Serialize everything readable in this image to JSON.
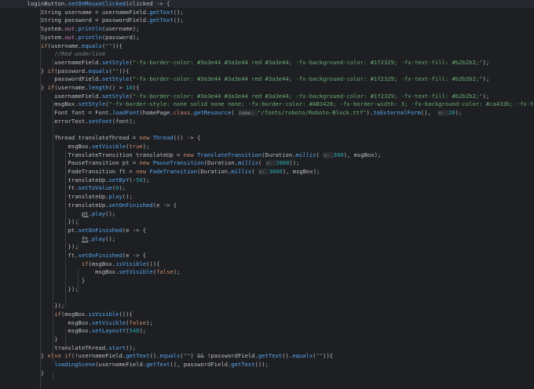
{
  "editor": {
    "language": "java",
    "lines": [
      [
        {
          "t": "        loginButton."
        },
        {
          "t": "setOnMouseClicked",
          "c": "fn"
        },
        {
          "t": "(clicked -> {"
        }
      ],
      [
        {
          "t": "            String username = usernameField."
        },
        {
          "t": "getText",
          "c": "fn"
        },
        {
          "t": "();"
        }
      ],
      [
        {
          "t": "            String password = passwordField."
        },
        {
          "t": "getText",
          "c": "fn"
        },
        {
          "t": "();"
        }
      ],
      [
        {
          "t": "            System."
        },
        {
          "t": "out",
          "c": "fld it"
        },
        {
          "t": "."
        },
        {
          "t": "println",
          "c": "fn"
        },
        {
          "t": "(username);"
        }
      ],
      [
        {
          "t": "            System."
        },
        {
          "t": "out",
          "c": "fld it"
        },
        {
          "t": "."
        },
        {
          "t": "println",
          "c": "fn"
        },
        {
          "t": "(password);"
        }
      ],
      [
        {
          "t": "            "
        },
        {
          "t": "if",
          "c": "kw"
        },
        {
          "t": "(username."
        },
        {
          "t": "equals",
          "c": "fn"
        },
        {
          "t": "("
        },
        {
          "t": "\"\"",
          "c": "str"
        },
        {
          "t": ")){"
        }
      ],
      [
        {
          "t": "                "
        },
        {
          "t": "//Red underline",
          "c": "cm"
        }
      ],
      [
        {
          "t": "                usernameField."
        },
        {
          "t": "setStyle",
          "c": "fn"
        },
        {
          "t": "("
        },
        {
          "t": "\"-fx-border-color: #3a3e44 #3a3e44 red #3a3e44; -fx-background-color: #1f2329; -fx-text-fill: #b2b2b2;\"",
          "c": "str"
        },
        {
          "t": ");"
        }
      ],
      [
        {
          "t": "            } "
        },
        {
          "t": "if",
          "c": "kw"
        },
        {
          "t": "(password."
        },
        {
          "t": "equals",
          "c": "fn"
        },
        {
          "t": "("
        },
        {
          "t": "\"\"",
          "c": "str"
        },
        {
          "t": ")){"
        }
      ],
      [
        {
          "t": "                passwordField."
        },
        {
          "t": "setStyle",
          "c": "fn"
        },
        {
          "t": "("
        },
        {
          "t": "\"-fx-border-color: #3a3e44 #3a3e44 red #3a3e44; -fx-background-color: #1f2329; -fx-text-fill: #b2b2b2;\"",
          "c": "str"
        },
        {
          "t": ");"
        }
      ],
      [
        {
          "t": "            } "
        },
        {
          "t": "if",
          "c": "kw"
        },
        {
          "t": "(username."
        },
        {
          "t": "length",
          "c": "fn"
        },
        {
          "t": "() > "
        },
        {
          "t": "10",
          "c": "num"
        },
        {
          "t": "){"
        }
      ],
      [
        {
          "t": "                usernameField."
        },
        {
          "t": "setStyle",
          "c": "fn"
        },
        {
          "t": "("
        },
        {
          "t": "\"-fx-border-color: #3a3e44 #3a3e44 red #3a3e44; -fx-background-color: #1f2329; -fx-text-fill: #b2b2b2;\"",
          "c": "str"
        },
        {
          "t": ");"
        }
      ],
      [
        {
          "t": "                msgBox."
        },
        {
          "t": "setStyle",
          "c": "fn"
        },
        {
          "t": "("
        },
        {
          "t": "\"-fx-border-style: none solid none none; -fx-border-color: #AB3428; -fx-border-width: 3; -fx-background-color: #ca433b; -fx-text-fill: white;\"",
          "c": "str"
        },
        {
          "t": ");"
        }
      ],
      [
        {
          "t": "                Font font = Font."
        },
        {
          "t": "loadFont",
          "c": "fn it"
        },
        {
          "t": "(homePage."
        },
        {
          "t": "class",
          "c": "kw"
        },
        {
          "t": "."
        },
        {
          "t": "getResource",
          "c": "fn"
        },
        {
          "t": "( "
        },
        {
          "t": "name: ",
          "c": "hint"
        },
        {
          "t": "\"/fonts/roboto/Roboto-Black.ttf\"",
          "c": "str"
        },
        {
          "t": ")."
        },
        {
          "t": "toExternalForm",
          "c": "fn"
        },
        {
          "t": "(),  "
        },
        {
          "t": "v: ",
          "c": "hint"
        },
        {
          "t": "20",
          "c": "num"
        },
        {
          "t": ");"
        }
      ],
      [
        {
          "t": "                errorText."
        },
        {
          "t": "setFont",
          "c": "fn"
        },
        {
          "t": "(font);"
        }
      ],
      [
        {
          "t": ""
        }
      ],
      [
        {
          "t": "                Thread translateThread = "
        },
        {
          "t": "new",
          "c": "kw"
        },
        {
          "t": " "
        },
        {
          "t": "Thread",
          "c": "fn"
        },
        {
          "t": "(() -> {"
        }
      ],
      [
        {
          "t": "                    msgBox."
        },
        {
          "t": "setVisible",
          "c": "fn"
        },
        {
          "t": "("
        },
        {
          "t": "true",
          "c": "kw"
        },
        {
          "t": ");"
        }
      ],
      [
        {
          "t": "                    TranslateTransition translateUp = "
        },
        {
          "t": "new",
          "c": "kw"
        },
        {
          "t": " "
        },
        {
          "t": "TranslateTransition",
          "c": "fn"
        },
        {
          "t": "(Duration."
        },
        {
          "t": "millis",
          "c": "fn it"
        },
        {
          "t": "( "
        },
        {
          "t": "v: ",
          "c": "hint"
        },
        {
          "t": "300",
          "c": "num"
        },
        {
          "t": "), msgBox);"
        }
      ],
      [
        {
          "t": "                    PauseTransition pt = "
        },
        {
          "t": "new",
          "c": "kw"
        },
        {
          "t": " "
        },
        {
          "t": "PauseTransition",
          "c": "fn"
        },
        {
          "t": "(Duration."
        },
        {
          "t": "millis",
          "c": "fn it"
        },
        {
          "t": "( "
        },
        {
          "t": "v: ",
          "c": "hint"
        },
        {
          "t": "2000",
          "c": "num"
        },
        {
          "t": "));"
        }
      ],
      [
        {
          "t": "                    FadeTransition ft = "
        },
        {
          "t": "new",
          "c": "kw"
        },
        {
          "t": " "
        },
        {
          "t": "FadeTransition",
          "c": "fn"
        },
        {
          "t": "(Duration."
        },
        {
          "t": "millis",
          "c": "fn it"
        },
        {
          "t": "( "
        },
        {
          "t": "v: ",
          "c": "hint"
        },
        {
          "t": "3000",
          "c": "num"
        },
        {
          "t": "), msgBox);"
        }
      ],
      [
        {
          "t": "                    translateUp."
        },
        {
          "t": "setByY",
          "c": "fn"
        },
        {
          "t": "(-"
        },
        {
          "t": "50",
          "c": "num"
        },
        {
          "t": ");"
        }
      ],
      [
        {
          "t": "                    ft."
        },
        {
          "t": "setToValue",
          "c": "fn"
        },
        {
          "t": "("
        },
        {
          "t": "0",
          "c": "num"
        },
        {
          "t": ");"
        }
      ],
      [
        {
          "t": "                    translateUp."
        },
        {
          "t": "play",
          "c": "fn"
        },
        {
          "t": "();"
        }
      ],
      [
        {
          "t": "                    translateUp."
        },
        {
          "t": "setOnFinished",
          "c": "fn"
        },
        {
          "t": "(e -> {"
        }
      ],
      [
        {
          "t": "                        "
        },
        {
          "t": "pt",
          "c": "ul"
        },
        {
          "t": "."
        },
        {
          "t": "play",
          "c": "fn"
        },
        {
          "t": "();"
        }
      ],
      [
        {
          "t": "                    });"
        }
      ],
      [
        {
          "t": "                    pt."
        },
        {
          "t": "setOnFinished",
          "c": "fn"
        },
        {
          "t": "(e -> {"
        }
      ],
      [
        {
          "t": "                        "
        },
        {
          "t": "ft",
          "c": "ul"
        },
        {
          "t": "."
        },
        {
          "t": "play",
          "c": "fn"
        },
        {
          "t": "();"
        }
      ],
      [
        {
          "t": "                    });"
        }
      ],
      [
        {
          "t": "                    ft."
        },
        {
          "t": "setOnFinished",
          "c": "fn"
        },
        {
          "t": "(e -> {"
        }
      ],
      [
        {
          "t": "                        "
        },
        {
          "t": "if",
          "c": "kw"
        },
        {
          "t": "(msgBox."
        },
        {
          "t": "isVisible",
          "c": "fn"
        },
        {
          "t": "()){"
        }
      ],
      [
        {
          "t": "                            msgBox."
        },
        {
          "t": "setVisible",
          "c": "fn"
        },
        {
          "t": "("
        },
        {
          "t": "false",
          "c": "kw"
        },
        {
          "t": ");"
        }
      ],
      [
        {
          "t": "                        }"
        }
      ],
      [
        {
          "t": "                    });"
        }
      ],
      [
        {
          "t": ""
        }
      ],
      [
        {
          "t": "                });"
        }
      ],
      [
        {
          "t": "                "
        },
        {
          "t": "if",
          "c": "kw"
        },
        {
          "t": "(msgBox."
        },
        {
          "t": "isVisible",
          "c": "fn"
        },
        {
          "t": "()){"
        }
      ],
      [
        {
          "t": "                    msgBox."
        },
        {
          "t": "setVisible",
          "c": "fn"
        },
        {
          "t": "("
        },
        {
          "t": "false",
          "c": "kw"
        },
        {
          "t": ");"
        }
      ],
      [
        {
          "t": "                    msgBox."
        },
        {
          "t": "setLayoutY",
          "c": "fn"
        },
        {
          "t": "("
        },
        {
          "t": "546",
          "c": "num"
        },
        {
          "t": ");"
        }
      ],
      [
        {
          "t": "                }"
        }
      ],
      [
        {
          "t": "                translateThread."
        },
        {
          "t": "start",
          "c": "fn"
        },
        {
          "t": "();"
        }
      ],
      [
        {
          "t": "            } "
        },
        {
          "t": "else if",
          "c": "kw"
        },
        {
          "t": "(!usernameField."
        },
        {
          "t": "getText",
          "c": "fn"
        },
        {
          "t": "()."
        },
        {
          "t": "equals",
          "c": "fn"
        },
        {
          "t": "("
        },
        {
          "t": "\"\"",
          "c": "str"
        },
        {
          "t": ") && !passwordField."
        },
        {
          "t": "getText",
          "c": "fn"
        },
        {
          "t": "()."
        },
        {
          "t": "equals",
          "c": "fn"
        },
        {
          "t": "("
        },
        {
          "t": "\"\"",
          "c": "str"
        },
        {
          "t": ")){"
        }
      ],
      [
        {
          "t": "                "
        },
        {
          "t": "loadingScene",
          "c": "fn"
        },
        {
          "t": "(usernameField."
        },
        {
          "t": "getText",
          "c": "fn"
        },
        {
          "t": "(), passwordField."
        },
        {
          "t": "getText",
          "c": "fn"
        },
        {
          "t": "());"
        }
      ],
      [
        {
          "t": "            }"
        }
      ]
    ],
    "colors": {
      "background": "#1e1f22",
      "text": "#bcbec4",
      "keyword": "#cf8e6d",
      "string": "#6aab73",
      "number": "#2aacb8",
      "method": "#56a8f5",
      "field": "#c77dbb",
      "comment": "#7a7e85"
    }
  }
}
